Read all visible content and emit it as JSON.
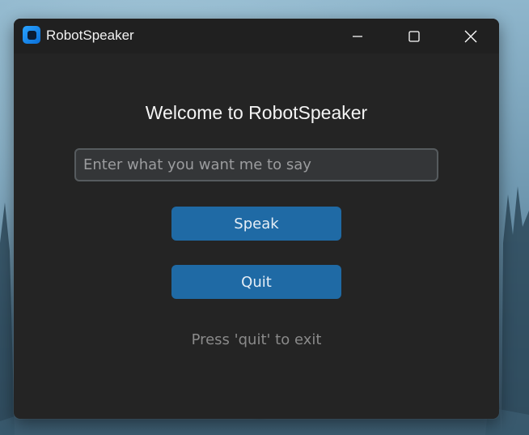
{
  "window": {
    "title": "RobotSpeaker",
    "icon": "app-icon",
    "controls": {
      "minimize": "minimize-icon",
      "maximize": "maximize-icon",
      "close": "close-icon"
    }
  },
  "main": {
    "heading": "Welcome to RobotSpeaker",
    "input": {
      "value": "",
      "placeholder": "Enter what you want me to say"
    },
    "speak_label": "Speak",
    "quit_label": "Quit",
    "hint": "Press 'quit' to exit"
  },
  "colors": {
    "window_bg": "#242424",
    "titlebar_bg": "#202020",
    "button_bg": "#1f6aa5",
    "input_bg": "#343638",
    "input_border": "#565b5e",
    "hint_text": "#8a8a8a"
  }
}
